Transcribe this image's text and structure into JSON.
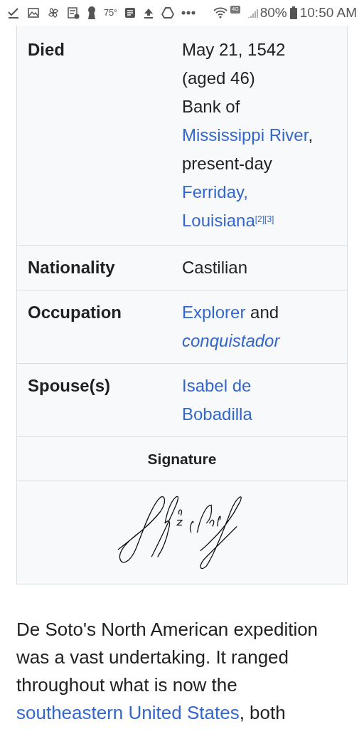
{
  "status_bar": {
    "temperature": "75°",
    "network": "4G",
    "battery": "80%",
    "time": "10:50 AM"
  },
  "infobox": {
    "rows": [
      {
        "label": "Died",
        "value": [
          {
            "kind": "text",
            "text": "May 21, 1542"
          },
          {
            "kind": "break"
          },
          {
            "kind": "text",
            "text": "(aged 46)"
          },
          {
            "kind": "break"
          },
          {
            "kind": "text",
            "text": "Bank of"
          },
          {
            "kind": "break"
          },
          {
            "kind": "link",
            "text": "Mississippi River"
          },
          {
            "kind": "text",
            "text": ","
          },
          {
            "kind": "break"
          },
          {
            "kind": "text",
            "text": "present-day"
          },
          {
            "kind": "break"
          },
          {
            "kind": "link",
            "text": "Ferriday,"
          },
          {
            "kind": "break"
          },
          {
            "kind": "link",
            "text": "Louisiana"
          },
          {
            "kind": "ref",
            "text": "[2]"
          },
          {
            "kind": "ref",
            "text": "[3]"
          }
        ]
      },
      {
        "label": "Nationality",
        "value": [
          {
            "kind": "text",
            "text": "Castilian"
          }
        ]
      },
      {
        "label": "Occupation",
        "value": [
          {
            "kind": "link",
            "text": "Explorer"
          },
          {
            "kind": "text",
            "text": " and"
          },
          {
            "kind": "break"
          },
          {
            "kind": "italic_link",
            "text": "conquistador"
          }
        ]
      },
      {
        "label": "Spouse(s)",
        "value": [
          {
            "kind": "link",
            "text": "Isabel de"
          },
          {
            "kind": "break"
          },
          {
            "kind": "link",
            "text": "Bobadilla"
          }
        ]
      }
    ],
    "signature_header": "Signature"
  },
  "paragraph": [
    {
      "kind": "text",
      "text": "De Soto's North American expedition was a vast undertaking. It ranged throughout what is now the "
    },
    {
      "kind": "link",
      "text": "southeastern United States"
    },
    {
      "kind": "text",
      "text": ", both"
    }
  ]
}
